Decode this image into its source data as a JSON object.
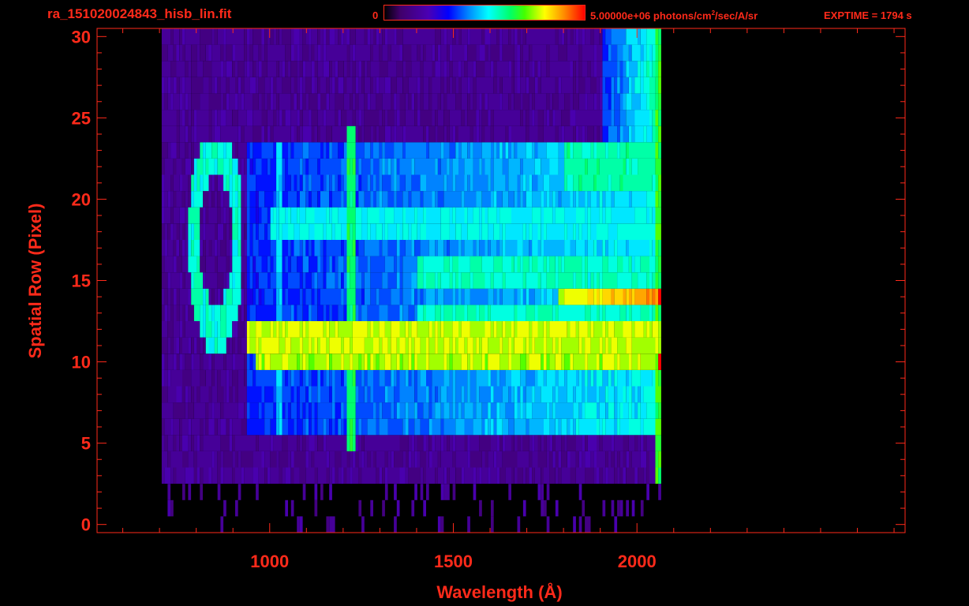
{
  "header": {
    "filename": "ra_151020024843_hisb_lin.fit",
    "colorbar_min": "0",
    "colorbar_max_value": "5.00000e+06 photons/cm",
    "colorbar_max_exp": "2",
    "colorbar_max_rest": "/sec/A/sr",
    "exptime": "EXPTIME = 1794 s"
  },
  "colors": {
    "axis": "#ff2a1a",
    "background": "#000000"
  },
  "chart_data": {
    "type": "heatmap",
    "title": "ra_151020024843_hisb_lin.fit",
    "xlabel": "Wavelength (Å)",
    "ylabel": "Spatial Row (Pixel)",
    "xlim": [
      530,
      2730
    ],
    "ylim": [
      -0.5,
      30.5
    ],
    "x_ticks": [
      1000,
      1500,
      2000
    ],
    "x_tick_labels": [
      "1000",
      "1500",
      "2000"
    ],
    "y_ticks": [
      0,
      5,
      10,
      15,
      20,
      25,
      30
    ],
    "y_tick_labels": [
      "0",
      "5",
      "10",
      "15",
      "20",
      "25",
      "30"
    ],
    "colorscale_range": [
      0,
      5000000
    ],
    "colorscale_units": "photons/cm^2/sec/A/sr",
    "grid": false,
    "features": [
      {
        "kind": "continuum_band",
        "rows": [
          11,
          12
        ],
        "x": [
          930,
          2060
        ],
        "level": 0.78
      },
      {
        "kind": "continuum_band",
        "rows": [
          10,
          11
        ],
        "x": [
          960,
          2060
        ],
        "level": 0.76
      },
      {
        "kind": "continuum_band",
        "rows": [
          14,
          15
        ],
        "x": [
          1780,
          2060
        ],
        "level": 0.85
      },
      {
        "kind": "emission_line",
        "x": 1216,
        "rows": [
          5,
          24
        ],
        "level": 0.62
      },
      {
        "kind": "emission_line",
        "x": 1025,
        "rows": [
          5,
          23
        ],
        "level": 0.5
      },
      {
        "kind": "detector_edge",
        "x": 2060,
        "rows": [
          0,
          30
        ],
        "level": 0.7
      }
    ]
  }
}
